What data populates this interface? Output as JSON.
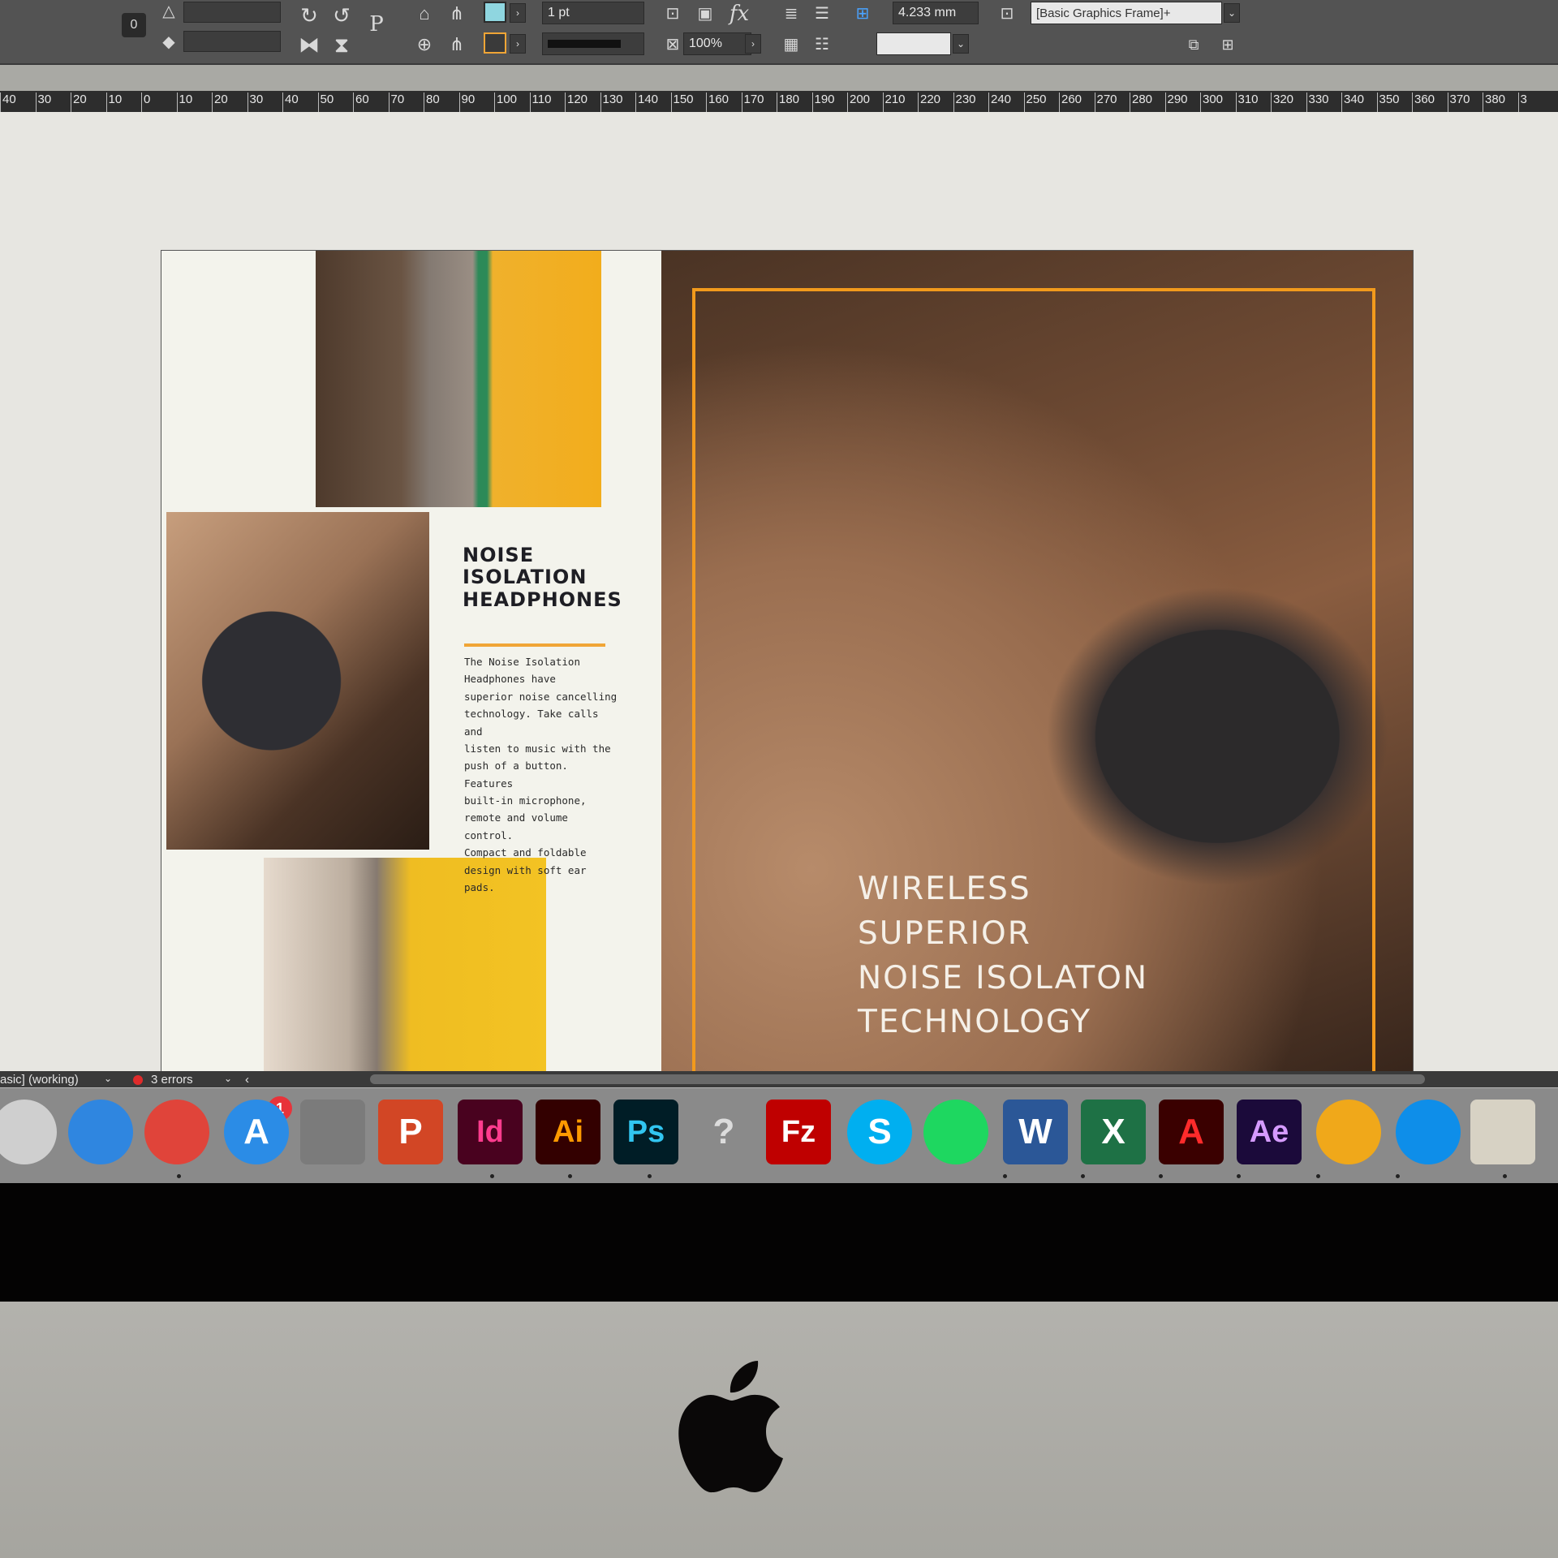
{
  "control_bar": {
    "stroke_weight": "1 pt",
    "dimension_value": "4.233 mm",
    "object_style": "[Basic Graphics Frame]+",
    "opacity": "100%",
    "reference_point_label": "0",
    "paragraph_icon": "P"
  },
  "ruler": {
    "ticks": [
      "40",
      "30",
      "20",
      "10",
      "0",
      "10",
      "20",
      "30",
      "40",
      "50",
      "60",
      "70",
      "80",
      "90",
      "100",
      "110",
      "120",
      "130",
      "140",
      "150",
      "160",
      "170",
      "180",
      "190",
      "200",
      "210",
      "220",
      "230",
      "240",
      "250",
      "260",
      "270",
      "280",
      "290",
      "300",
      "310",
      "320",
      "330",
      "340",
      "350",
      "360",
      "370",
      "380",
      "3"
    ]
  },
  "document": {
    "heading_lines": [
      "NOISE",
      "ISOLATION",
      "HEADPHONES"
    ],
    "body_lines": [
      "The Noise Isolation",
      "Headphones have",
      "superior noise cancelling",
      "technology. Take calls and",
      "listen to music with the",
      "push of a button. Features",
      "built-in microphone,",
      "remote and volume control.",
      "Compact and foldable",
      "design with soft ear pads."
    ],
    "hero_lines": [
      "WIRELESS",
      "SUPERIOR",
      "NOISE ISOLATON",
      "TECHNOLOGY"
    ]
  },
  "status_bar": {
    "profile": "asic] (working)",
    "errors": "3 errors"
  },
  "dock": {
    "apps": [
      {
        "name": "launchpad",
        "label": "",
        "bg": "#cfcfcf",
        "fg": "#333"
      },
      {
        "name": "safari",
        "label": "",
        "bg": "#2f86e0",
        "fg": "#fff"
      },
      {
        "name": "chrome",
        "label": "",
        "bg": "#e0443a",
        "fg": "#fff"
      },
      {
        "name": "app-store",
        "label": "A",
        "bg": "#2b8ce6",
        "fg": "#fff"
      },
      {
        "name": "system-preferences",
        "label": "",
        "bg": "#7b7b7b",
        "fg": "#eee"
      },
      {
        "name": "powerpoint",
        "label": "P",
        "bg": "#d24625",
        "fg": "#fff"
      },
      {
        "name": "indesign",
        "label": "Id",
        "bg": "#49021f",
        "fg": "#ff3c8e"
      },
      {
        "name": "illustrator",
        "label": "Ai",
        "bg": "#330000",
        "fg": "#ff9a00"
      },
      {
        "name": "photoshop",
        "label": "Ps",
        "bg": "#001d26",
        "fg": "#31c5f0"
      },
      {
        "name": "unknown-app",
        "label": "?",
        "bg": "transparent",
        "fg": "#dcdcdc"
      },
      {
        "name": "filezilla",
        "label": "Fz",
        "bg": "#bf0000",
        "fg": "#fff"
      },
      {
        "name": "skype",
        "label": "S",
        "bg": "#00aff0",
        "fg": "#fff"
      },
      {
        "name": "spotify",
        "label": "",
        "bg": "#1ed760",
        "fg": "#111"
      },
      {
        "name": "word",
        "label": "W",
        "bg": "#2b5797",
        "fg": "#fff"
      },
      {
        "name": "excel",
        "label": "X",
        "bg": "#1e7145",
        "fg": "#fff"
      },
      {
        "name": "acrobat",
        "label": "A",
        "bg": "#3a0000",
        "fg": "#ff2b2b"
      },
      {
        "name": "after-effects",
        "label": "Ae",
        "bg": "#1b0a3a",
        "fg": "#d59bff"
      },
      {
        "name": "phone-app",
        "label": "",
        "bg": "#f0a81a",
        "fg": "#fff"
      },
      {
        "name": "teamviewer",
        "label": "",
        "bg": "#0e8ee9",
        "fg": "#fff"
      },
      {
        "name": "preview",
        "label": "",
        "bg": "#d7d2c4",
        "fg": "#333"
      }
    ],
    "badge": "1"
  },
  "colors": {
    "accent_orange": "#f29a1c",
    "ui_dark": "#535353",
    "error_red": "#e02b2b"
  }
}
